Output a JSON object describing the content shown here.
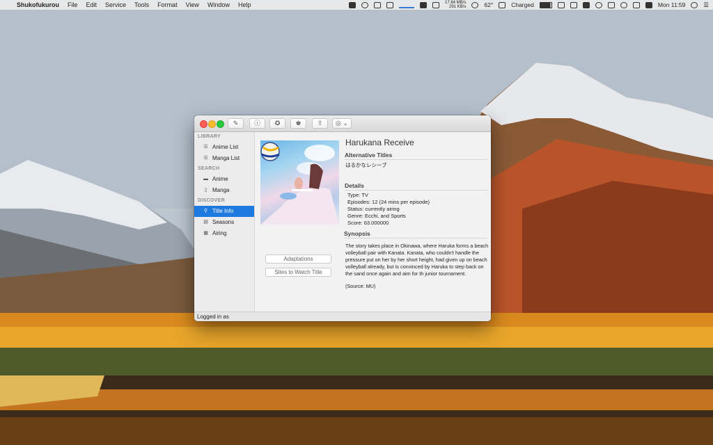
{
  "menubar": {
    "app_name": "Shukofukurou",
    "items": [
      "File",
      "Edit",
      "Service",
      "Tools",
      "Format",
      "View",
      "Window",
      "Help"
    ],
    "net_up": "17.64 MB/s",
    "net_down": "291 KB/s",
    "temperature": "62°",
    "battery_label": "Charged",
    "clock": "Mon 11:59"
  },
  "window": {
    "toolbar": {
      "buttons": [
        "pencil-icon",
        "info-icon",
        "star-icon",
        "people-icon",
        "share-icon",
        "globe-icon"
      ]
    },
    "sidebar": {
      "sections": [
        {
          "header": "LIBRARY",
          "items": [
            {
              "label": "Anime List",
              "icon": "list-icon"
            },
            {
              "label": "Manga List",
              "icon": "list-icon"
            }
          ]
        },
        {
          "header": "SEARCH",
          "items": [
            {
              "label": "Anime",
              "icon": "tv-icon"
            },
            {
              "label": "Manga",
              "icon": "book-icon"
            }
          ]
        },
        {
          "header": "DISCOVER",
          "items": [
            {
              "label": "Title Info",
              "icon": "search-icon"
            },
            {
              "label": "Seasons",
              "icon": "seasons-icon"
            },
            {
              "label": "Airing",
              "icon": "calendar-icon"
            }
          ]
        }
      ],
      "selected": "Title Info"
    },
    "detail": {
      "title": "Harukana Receive",
      "alt_titles_heading": "Alternative Titles",
      "alt_title": "はるかなレシーブ",
      "details_heading": "Details",
      "type": "Type: TV",
      "episodes": "Episodes: 12 (24 mins per episode)",
      "status": "Status: currently airing",
      "genre": "Genre: Ecchi, and Sports",
      "score": "Score: 63.000000",
      "synopsis_heading": "Synopsis",
      "synopsis": "The story takes place in Okinawa, where Haruka forms a beach volleyball pair with Kanata. Kanata, who couldn't handle the pressure put on her by her short height, had given up on beach volleyball already, but is convinced by Haruka to step back on the sand once again and aim for th junior tournament.",
      "source": "(Source: MU)"
    },
    "buttons": {
      "adaptations": "Adaptations",
      "sites": "Sites to Watch Title"
    },
    "status_text": "Logged in as"
  }
}
